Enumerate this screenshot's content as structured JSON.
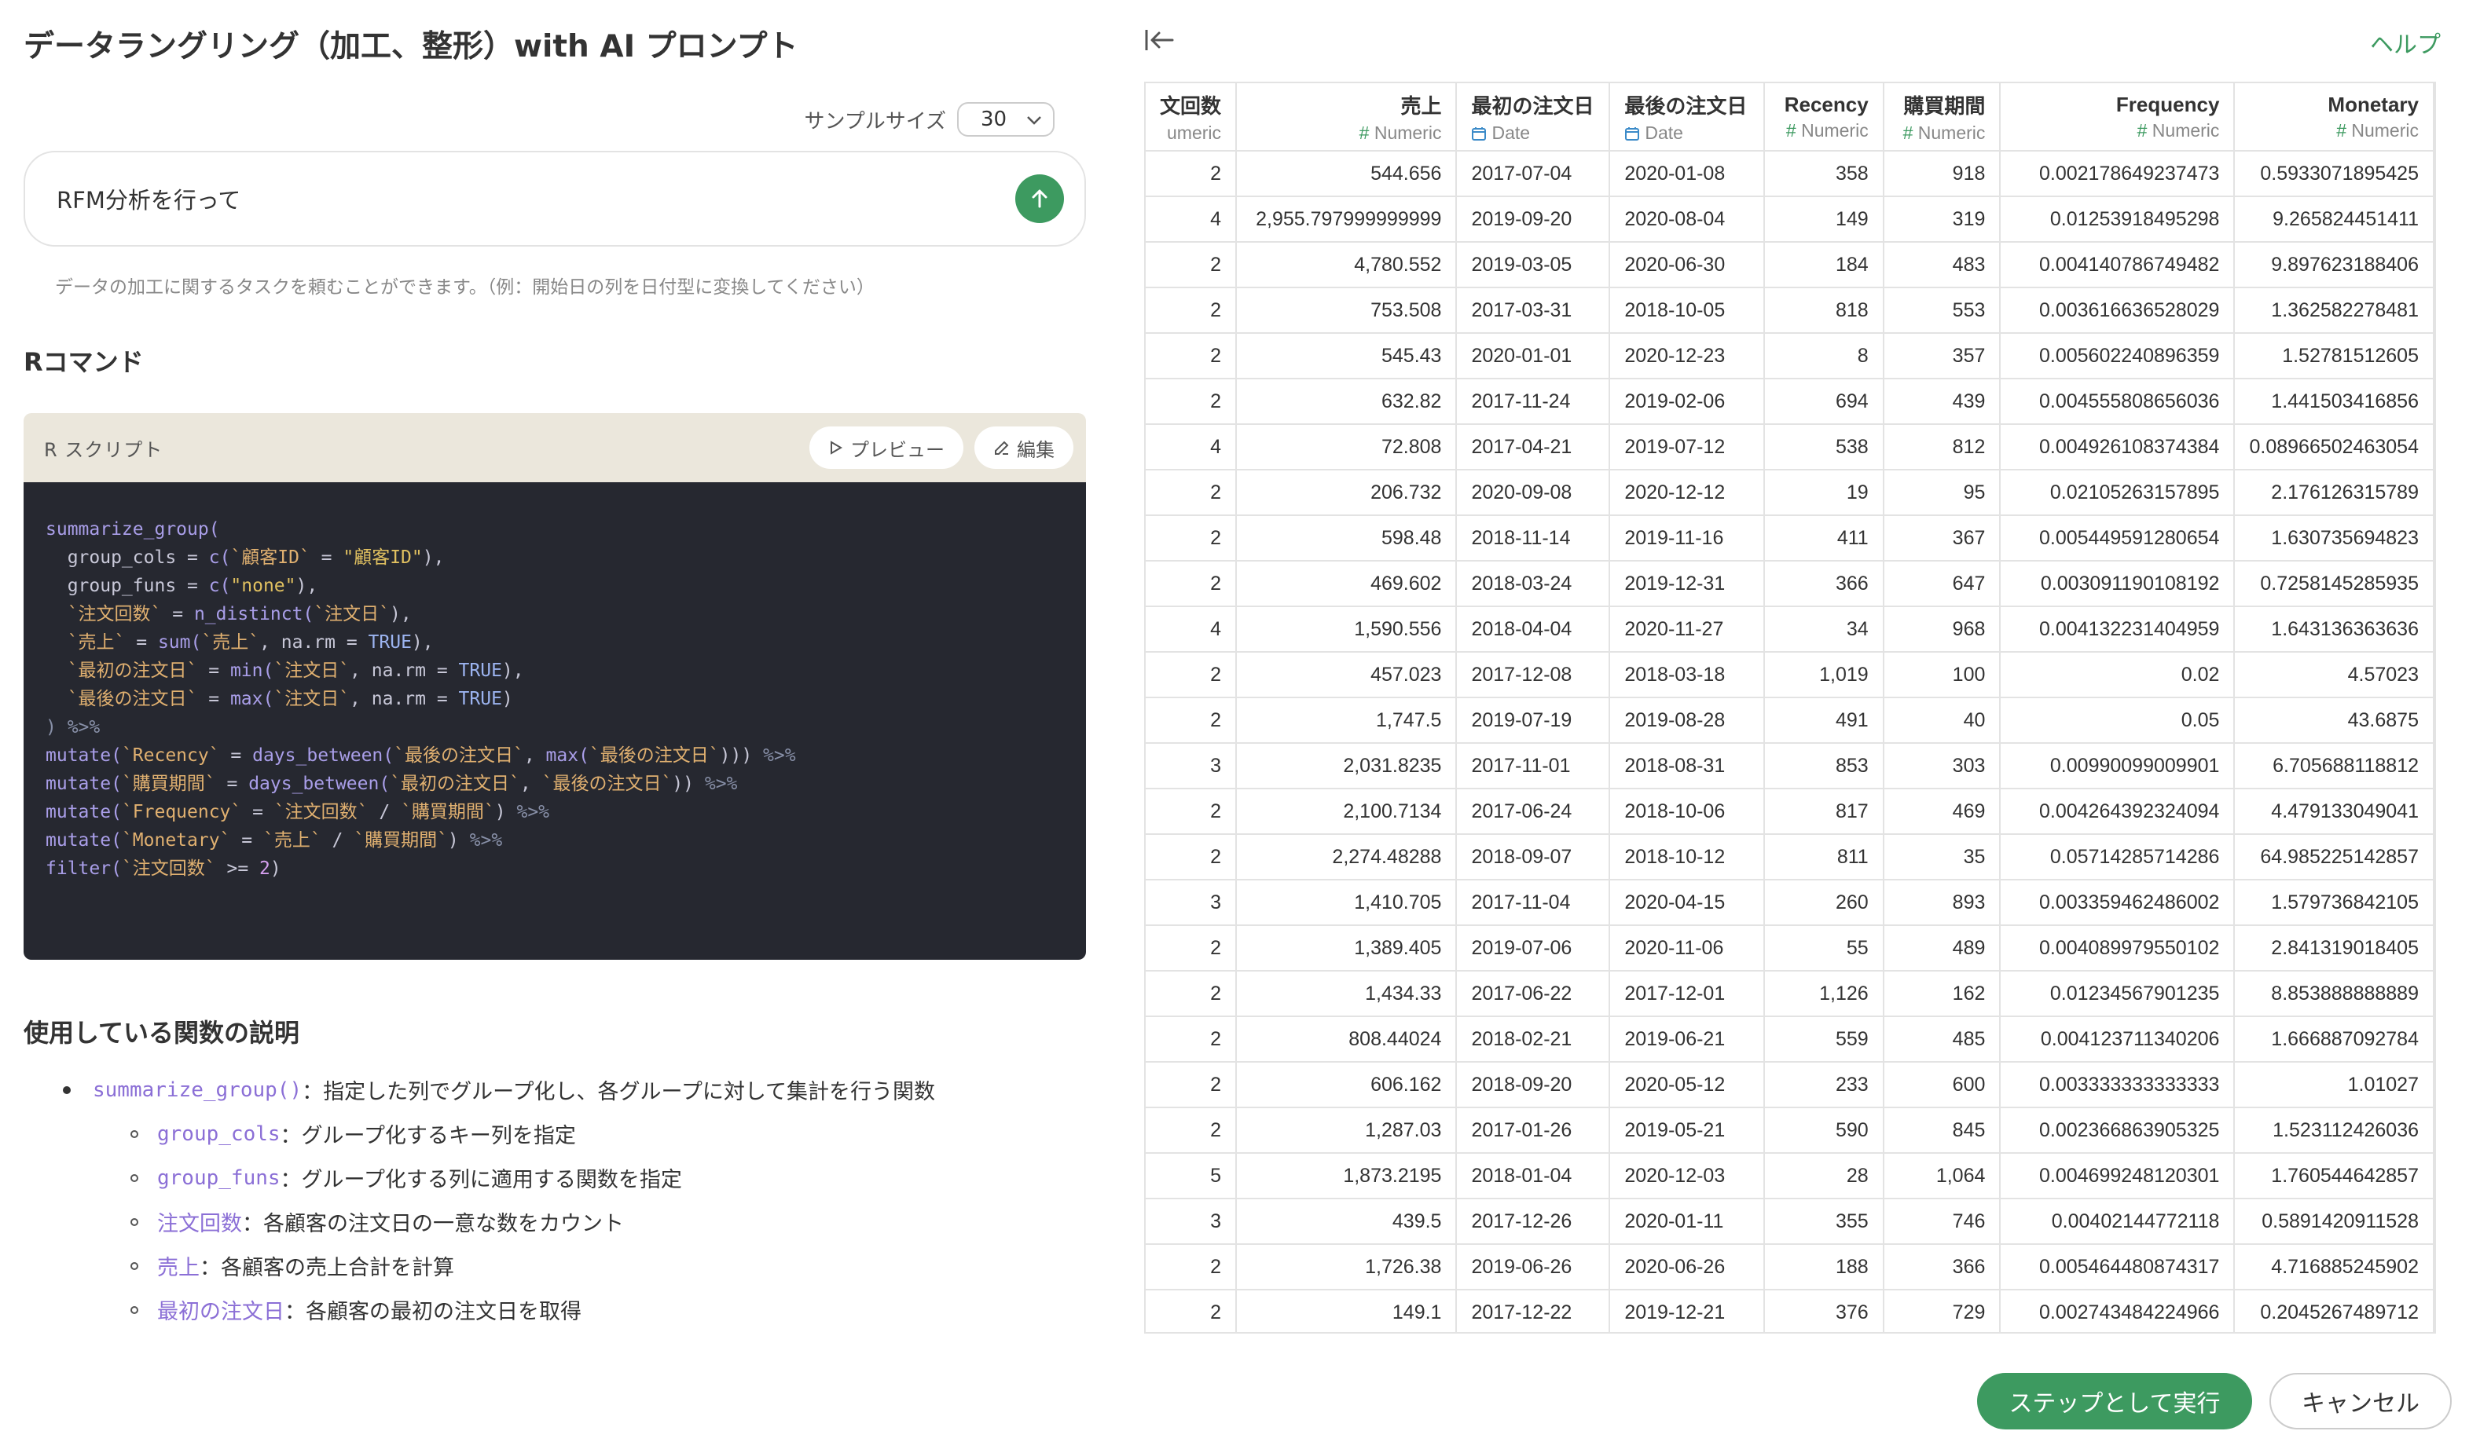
{
  "header": {
    "title": "データラングリング（加工、整形）with AI プロンプト",
    "help_label": "ヘルプ"
  },
  "sample": {
    "label": "サンプルサイズ",
    "value": "30"
  },
  "prompt": {
    "text": "RFM分析を行って",
    "hint": "データの加工に関するタスクを頼むことができます。（例：開始日の列を日付型に変換してください）"
  },
  "rcommand": {
    "heading": "Rコマンド",
    "script_label": "R スクリプト",
    "preview_label": "プレビュー",
    "edit_label": "編集",
    "code_lines": [
      [
        [
          "fn",
          "summarize_group("
        ]
      ],
      [
        [
          "",
          "  group_cols = "
        ],
        [
          "fn",
          "c("
        ],
        [
          "bt",
          "`顧客ID`"
        ],
        [
          "",
          " = "
        ],
        [
          "str",
          "\"顧客ID\""
        ],
        [
          "",
          "),"
        ]
      ],
      [
        [
          "",
          "  group_funs = "
        ],
        [
          "fn",
          "c("
        ],
        [
          "str",
          "\"none\""
        ],
        [
          "",
          "),"
        ]
      ],
      [
        [
          "",
          "  "
        ],
        [
          "bt",
          "`注文回数`"
        ],
        [
          "",
          " = "
        ],
        [
          "fn",
          "n_distinct("
        ],
        [
          "bt",
          "`注文日`"
        ],
        [
          "",
          "),"
        ]
      ],
      [
        [
          "",
          "  "
        ],
        [
          "bt",
          "`売上`"
        ],
        [
          "",
          " = "
        ],
        [
          "fn",
          "sum("
        ],
        [
          "bt",
          "`売上`"
        ],
        [
          "",
          ", na.rm = "
        ],
        [
          "kw",
          "TRUE"
        ],
        [
          "",
          "),"
        ]
      ],
      [
        [
          "",
          "  "
        ],
        [
          "bt",
          "`最初の注文日`"
        ],
        [
          "",
          " = "
        ],
        [
          "fn",
          "min("
        ],
        [
          "bt",
          "`注文日`"
        ],
        [
          "",
          ", na.rm = "
        ],
        [
          "kw",
          "TRUE"
        ],
        [
          "",
          "),"
        ]
      ],
      [
        [
          "",
          "  "
        ],
        [
          "bt",
          "`最後の注文日`"
        ],
        [
          "",
          " = "
        ],
        [
          "fn",
          "max("
        ],
        [
          "bt",
          "`注文日`"
        ],
        [
          "",
          ", na.rm = "
        ],
        [
          "kw",
          "TRUE"
        ],
        [
          "",
          ")"
        ]
      ],
      [
        [
          "op",
          ") %>%"
        ]
      ],
      [
        [
          "fn",
          "mutate("
        ],
        [
          "bt",
          "`Recency`"
        ],
        [
          "",
          " = "
        ],
        [
          "fn",
          "days_between("
        ],
        [
          "bt",
          "`最後の注文日`"
        ],
        [
          "",
          ", "
        ],
        [
          "fn",
          "max("
        ],
        [
          "bt",
          "`最後の注文日`"
        ],
        [
          "",
          ")))"
        ],
        [
          "op",
          " %>%"
        ]
      ],
      [
        [
          "fn",
          "mutate("
        ],
        [
          "bt",
          "`購買期間`"
        ],
        [
          "",
          " = "
        ],
        [
          "fn",
          "days_between("
        ],
        [
          "bt",
          "`最初の注文日`"
        ],
        [
          "",
          ", "
        ],
        [
          "bt",
          "`最後の注文日`"
        ],
        [
          "",
          "))"
        ],
        [
          "op",
          " %>%"
        ]
      ],
      [
        [
          "fn",
          "mutate("
        ],
        [
          "bt",
          "`Frequency`"
        ],
        [
          "",
          " = "
        ],
        [
          "bt",
          "`注文回数`"
        ],
        [
          "",
          " / "
        ],
        [
          "bt",
          "`購買期間`"
        ],
        [
          "",
          ")"
        ],
        [
          "op",
          " %>%"
        ]
      ],
      [
        [
          "fn",
          "mutate("
        ],
        [
          "bt",
          "`Monetary`"
        ],
        [
          "",
          " = "
        ],
        [
          "bt",
          "`売上`"
        ],
        [
          "",
          " / "
        ],
        [
          "bt",
          "`購買期間`"
        ],
        [
          "",
          ")"
        ],
        [
          "op",
          " %>%"
        ]
      ],
      [
        [
          "fn",
          "filter("
        ],
        [
          "bt",
          "`注文回数`"
        ],
        [
          "",
          " >= "
        ],
        [
          "num",
          "2"
        ],
        [
          "",
          ")"
        ]
      ]
    ]
  },
  "functions": {
    "heading": "使用している関数の説明",
    "items": [
      {
        "code": "summarize_group()",
        "text": "：指定した列でグループ化し、各グループに対して集計を行う関数",
        "level": 1,
        "mono": true
      },
      {
        "code": "group_cols",
        "text": "：グループ化するキー列を指定",
        "level": 2,
        "mono": true
      },
      {
        "code": "group_funs",
        "text": "：グループ化する列に適用する関数を指定",
        "level": 2,
        "mono": true
      },
      {
        "code": "注文回数",
        "text": "：各顧客の注文日の一意な数をカウント",
        "level": 2,
        "mono": false
      },
      {
        "code": "売上",
        "text": "：各顧客の売上合計を計算",
        "level": 2,
        "mono": false
      },
      {
        "code": "最初の注文日",
        "text": "：各顧客の最初の注文日を取得",
        "level": 2,
        "mono": false
      }
    ]
  },
  "table": {
    "columns": [
      {
        "name": "文回数",
        "type": "umeric",
        "icon": "",
        "align": "r"
      },
      {
        "name": "売上",
        "type": "Numeric",
        "icon": "#",
        "align": "r"
      },
      {
        "name": "最初の注文日",
        "type": "Date",
        "icon": "cal",
        "align": "l"
      },
      {
        "name": "最後の注文日",
        "type": "Date",
        "icon": "cal",
        "align": "l"
      },
      {
        "name": "Recency",
        "type": "Numeric",
        "icon": "#",
        "align": "r"
      },
      {
        "name": "購買期間",
        "type": "Numeric",
        "icon": "#",
        "align": "r"
      },
      {
        "name": "Frequency",
        "type": "Numeric",
        "icon": "#",
        "align": "r"
      },
      {
        "name": "Monetary",
        "type": "Numeric",
        "icon": "#",
        "align": "r"
      }
    ],
    "rows": [
      [
        "2",
        "544.656",
        "2017-07-04",
        "2020-01-08",
        "358",
        "918",
        "0.002178649237473",
        "0.5933071895425"
      ],
      [
        "4",
        "2,955.797999999999",
        "2019-09-20",
        "2020-08-04",
        "149",
        "319",
        "0.01253918495298",
        "9.265824451411"
      ],
      [
        "2",
        "4,780.552",
        "2019-03-05",
        "2020-06-30",
        "184",
        "483",
        "0.004140786749482",
        "9.897623188406"
      ],
      [
        "2",
        "753.508",
        "2017-03-31",
        "2018-10-05",
        "818",
        "553",
        "0.003616636528029",
        "1.362582278481"
      ],
      [
        "2",
        "545.43",
        "2020-01-01",
        "2020-12-23",
        "8",
        "357",
        "0.005602240896359",
        "1.52781512605"
      ],
      [
        "2",
        "632.82",
        "2017-11-24",
        "2019-02-06",
        "694",
        "439",
        "0.004555808656036",
        "1.441503416856"
      ],
      [
        "4",
        "72.808",
        "2017-04-21",
        "2019-07-12",
        "538",
        "812",
        "0.004926108374384",
        "0.08966502463054"
      ],
      [
        "2",
        "206.732",
        "2020-09-08",
        "2020-12-12",
        "19",
        "95",
        "0.02105263157895",
        "2.176126315789"
      ],
      [
        "2",
        "598.48",
        "2018-11-14",
        "2019-11-16",
        "411",
        "367",
        "0.005449591280654",
        "1.630735694823"
      ],
      [
        "2",
        "469.602",
        "2018-03-24",
        "2019-12-31",
        "366",
        "647",
        "0.003091190108192",
        "0.7258145285935"
      ],
      [
        "4",
        "1,590.556",
        "2018-04-04",
        "2020-11-27",
        "34",
        "968",
        "0.004132231404959",
        "1.643136363636"
      ],
      [
        "2",
        "457.023",
        "2017-12-08",
        "2018-03-18",
        "1,019",
        "100",
        "0.02",
        "4.57023"
      ],
      [
        "2",
        "1,747.5",
        "2019-07-19",
        "2019-08-28",
        "491",
        "40",
        "0.05",
        "43.6875"
      ],
      [
        "3",
        "2,031.8235",
        "2017-11-01",
        "2018-08-31",
        "853",
        "303",
        "0.00990099009901",
        "6.705688118812"
      ],
      [
        "2",
        "2,100.7134",
        "2017-06-24",
        "2018-10-06",
        "817",
        "469",
        "0.004264392324094",
        "4.479133049041"
      ],
      [
        "2",
        "2,274.48288",
        "2018-09-07",
        "2018-10-12",
        "811",
        "35",
        "0.05714285714286",
        "64.985225142857"
      ],
      [
        "3",
        "1,410.705",
        "2017-11-04",
        "2020-04-15",
        "260",
        "893",
        "0.003359462486002",
        "1.579736842105"
      ],
      [
        "2",
        "1,389.405",
        "2019-07-06",
        "2020-11-06",
        "55",
        "489",
        "0.004089979550102",
        "2.841319018405"
      ],
      [
        "2",
        "1,434.33",
        "2017-06-22",
        "2017-12-01",
        "1,126",
        "162",
        "0.01234567901235",
        "8.853888888889"
      ],
      [
        "2",
        "808.44024",
        "2018-02-21",
        "2019-06-21",
        "559",
        "485",
        "0.004123711340206",
        "1.666887092784"
      ],
      [
        "2",
        "606.162",
        "2018-09-20",
        "2020-05-12",
        "233",
        "600",
        "0.003333333333333",
        "1.01027"
      ],
      [
        "2",
        "1,287.03",
        "2017-01-26",
        "2019-05-21",
        "590",
        "845",
        "0.002366863905325",
        "1.523112426036"
      ],
      [
        "5",
        "1,873.2195",
        "2018-01-04",
        "2020-12-03",
        "28",
        "1,064",
        "0.004699248120301",
        "1.760544642857"
      ],
      [
        "3",
        "439.5",
        "2017-12-26",
        "2020-01-11",
        "355",
        "746",
        "0.00402144772118",
        "0.5891420911528"
      ],
      [
        "2",
        "1,726.38",
        "2019-06-26",
        "2020-06-26",
        "188",
        "366",
        "0.005464480874317",
        "4.716885245902"
      ],
      [
        "2",
        "149.1",
        "2017-12-22",
        "2019-12-21",
        "376",
        "729",
        "0.002743484224966",
        "0.2045267489712"
      ]
    ]
  },
  "footer": {
    "run_label": "ステップとして実行",
    "cancel_label": "キャンセル"
  },
  "colors": {
    "accent": "#3d9a60",
    "code_bg": "#262830",
    "script_head_bg": "#ebe7dc",
    "link": "#8b6fd6"
  }
}
